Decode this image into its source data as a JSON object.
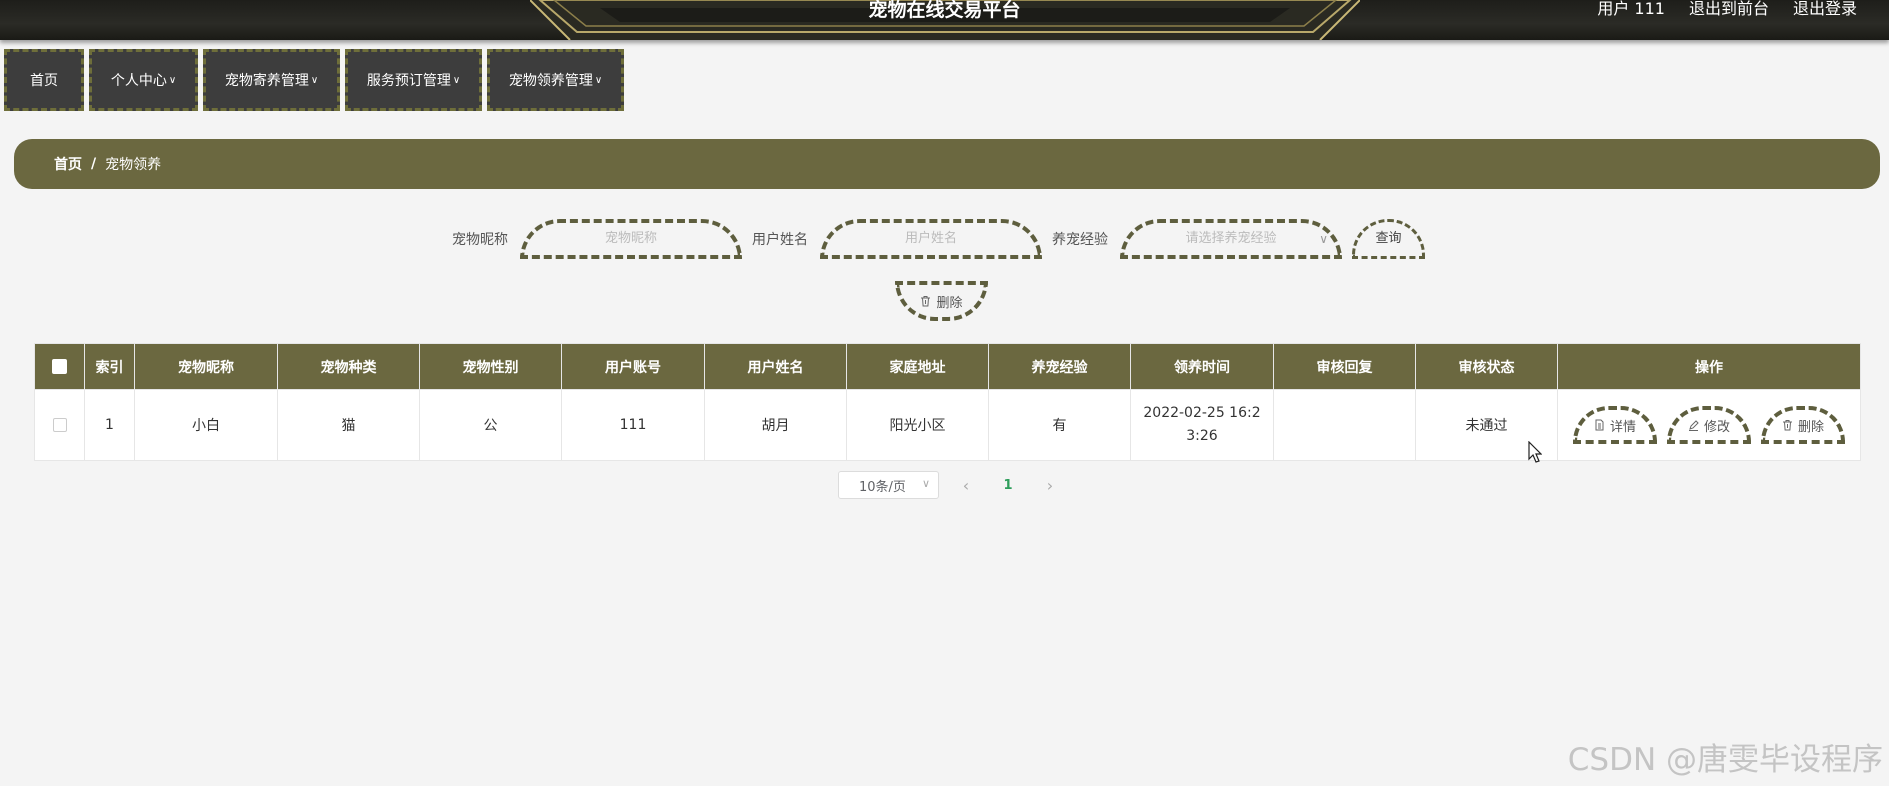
{
  "header": {
    "site_title": "宠物在线交易平台",
    "user_label": "用户 111",
    "back_to_front": "退出到前台",
    "logout": "退出登录"
  },
  "nav": {
    "items": [
      {
        "label": "首页",
        "has_dropdown": false
      },
      {
        "label": "个人中心",
        "has_dropdown": true
      },
      {
        "label": "宠物寄养管理",
        "has_dropdown": true
      },
      {
        "label": "服务预订管理",
        "has_dropdown": true
      },
      {
        "label": "宠物领养管理",
        "has_dropdown": true
      }
    ]
  },
  "breadcrumb": {
    "home": "首页",
    "separator": "/",
    "current": "宠物领养"
  },
  "search": {
    "pet_name_label": "宠物昵称",
    "pet_name_placeholder": "宠物昵称",
    "user_name_label": "用户姓名",
    "user_name_placeholder": "用户姓名",
    "experience_label": "养宠经验",
    "experience_placeholder": "请选择养宠经验",
    "query_button": "查询",
    "bulk_delete_button": "删除"
  },
  "table": {
    "columns": [
      "",
      "索引",
      "宠物昵称",
      "宠物种类",
      "宠物性别",
      "用户账号",
      "用户姓名",
      "家庭地址",
      "养宠经验",
      "领养时间",
      "审核回复",
      "审核状态",
      "操作"
    ],
    "rows": [
      {
        "index": "1",
        "pet_name": "小白",
        "pet_type": "猫",
        "pet_gender": "公",
        "user_account": "111",
        "user_name": "胡月",
        "address": "阳光小区",
        "experience": "有",
        "adopt_time_line1": "2022-02-25 16:2",
        "adopt_time_line2": "3:26",
        "review_reply": "",
        "review_status": "未通过",
        "actions": {
          "detail": "详情",
          "edit": "修改",
          "delete": "删除"
        }
      }
    ]
  },
  "pagination": {
    "page_size": "10条/页",
    "current_page": "1"
  },
  "watermark": "CSDN @唐雯毕设程序",
  "colors": {
    "olive": "#6b6840",
    "dashed_border": "#5e5e3e",
    "nav_bg": "#3d3d3d",
    "active_page": "#2e9e5b"
  },
  "icons": [
    "trash-icon",
    "document-icon",
    "pencil-icon",
    "chevron-down-icon",
    "chevron-left-icon",
    "chevron-right-icon",
    "mouse-cursor-icon"
  ]
}
